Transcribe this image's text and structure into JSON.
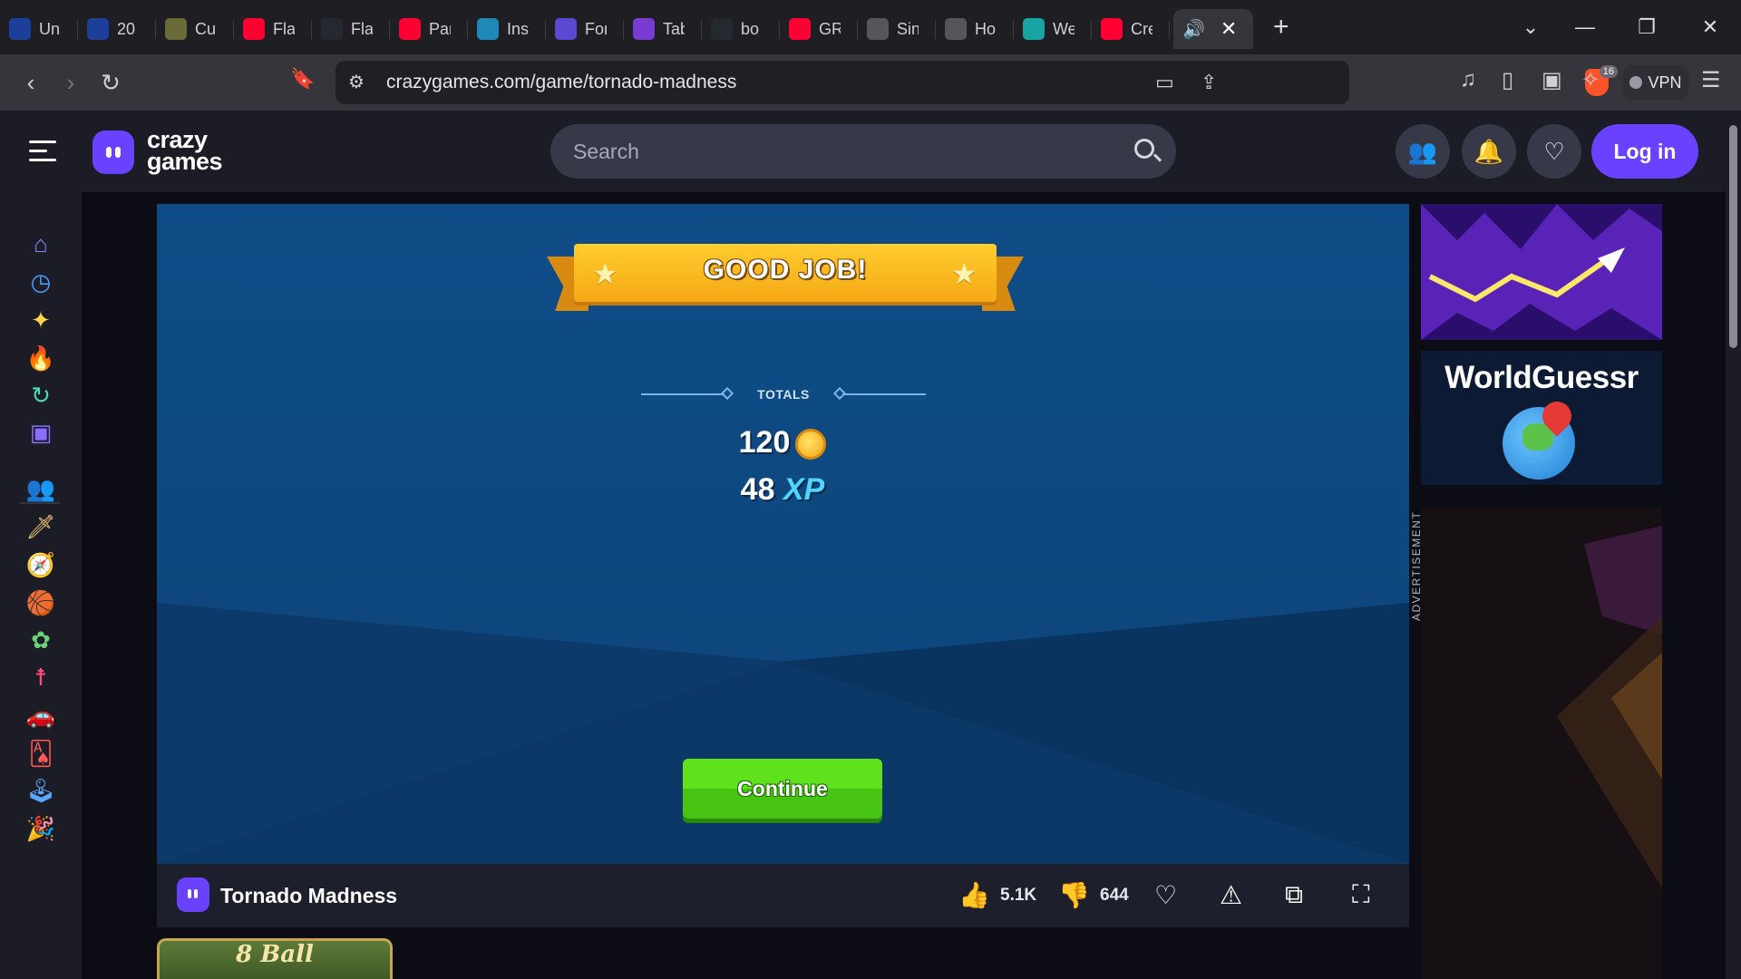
{
  "browser": {
    "tabs": [
      {
        "label": "Un",
        "icon": "usn-icon",
        "color": "#1c3f9a"
      },
      {
        "label": "20",
        "icon": "usn-icon",
        "color": "#1c3f9a"
      },
      {
        "label": "Cu",
        "icon": "grid-icon",
        "color": "#6b6b3a"
      },
      {
        "label": "Fla",
        "icon": "youtube-icon",
        "color": "#ff0033"
      },
      {
        "label": "Fla",
        "icon": "github-icon",
        "color": "#24292f"
      },
      {
        "label": "Par",
        "icon": "youtube-icon",
        "color": "#ff0033"
      },
      {
        "label": "Ins",
        "icon": "wave-icon",
        "color": "#1e88b6"
      },
      {
        "label": "For",
        "icon": "b-icon",
        "color": "#5b4ad1"
      },
      {
        "label": "Tab",
        "icon": "b-icon",
        "color": "#7b3ad1"
      },
      {
        "label": "bo",
        "icon": "github-icon",
        "color": "#24292f"
      },
      {
        "label": "GR",
        "icon": "youtube-icon",
        "color": "#ff0033"
      },
      {
        "label": "Sin",
        "icon": "globe-icon",
        "color": "#55555c"
      },
      {
        "label": "Ho",
        "icon": "globe-icon",
        "color": "#55555c"
      },
      {
        "label": "We",
        "icon": "s-icon",
        "color": "#19a3a3"
      },
      {
        "label": "Cre",
        "icon": "youtube-icon",
        "color": "#ff0033"
      }
    ],
    "url": "crazygames.com/game/tornado-madness",
    "shield_count": "16",
    "vpn_label": "VPN"
  },
  "site": {
    "logo_line1": "crazy",
    "logo_line2": "games",
    "search_placeholder": "Search",
    "login_label": "Log in",
    "sidebar_icons": [
      "home-icon",
      "clock-icon",
      "sparkle-icon",
      "fire-icon",
      "refresh-icon",
      "twitch-icon",
      "people-icon",
      "sword-icon",
      "compass-icon",
      "basketball-icon",
      "flower-icon",
      "stickman-icon",
      "car-icon",
      "cards-icon",
      "joystick-icon",
      "party-icon"
    ]
  },
  "game": {
    "banner": "GOOD JOB!",
    "totals_label": "TOTALS",
    "coins": "120",
    "xp": "48",
    "xp_suffix": "XP",
    "continue_label": "Continue",
    "name": "Tornado Madness",
    "likes": "5.1K",
    "dislikes": "644"
  },
  "ads": {
    "worldguessr": "WorldGuessr",
    "label": "ADVERTISEMENT"
  },
  "thumb": {
    "label": "8 Ball"
  },
  "colors": {
    "accent": "#6842ff",
    "continue": "#4fd21a",
    "banner": "#ffc325"
  }
}
